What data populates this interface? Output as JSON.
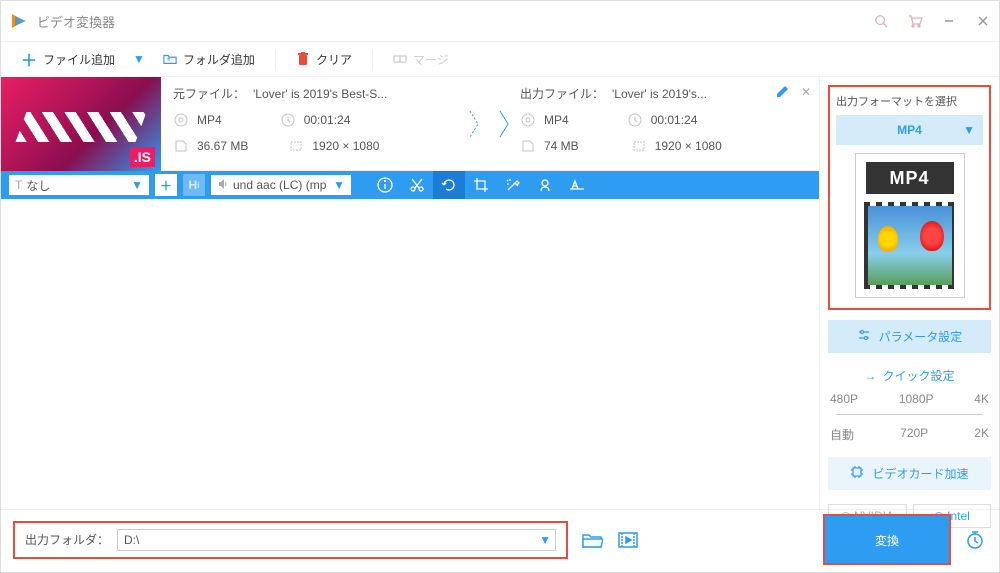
{
  "title": "ビデオ変換器",
  "toolbar": {
    "add_file": "ファイル追加",
    "add_folder": "フォルダ追加",
    "clear": "クリア",
    "merge": "マージ"
  },
  "item": {
    "src_label": "元ファイル：",
    "src_name": "'Lover' is 2019's Best-S...",
    "out_label": "出力ファイル：",
    "out_name": "'Lover' is 2019's...",
    "src_format": "MP4",
    "src_duration": "00:01:24",
    "src_size": "36.67 MB",
    "src_res": "1920 × 1080",
    "out_format": "MP4",
    "out_duration": "00:01:24",
    "out_size": "74 MB",
    "out_res": "1920 × 1080",
    "subtitle": "なし",
    "audio": "und aac (LC) (mp"
  },
  "right": {
    "format_title": "出力フォーマットを選択",
    "format_sel": "MP4",
    "format_img_label": "MP4",
    "param": "パラメータ設定",
    "quick": "クイック設定",
    "presets_top": [
      "480P",
      "1080P",
      "4K"
    ],
    "presets_bot": [
      "自動",
      "720P",
      "2K"
    ],
    "gpu": "ビデオカード加速",
    "nvidia": "NVIDIA",
    "intel": "Intel"
  },
  "bottom": {
    "out_label": "出力フォルダ：",
    "out_path": "D:\\",
    "convert": "変換"
  }
}
